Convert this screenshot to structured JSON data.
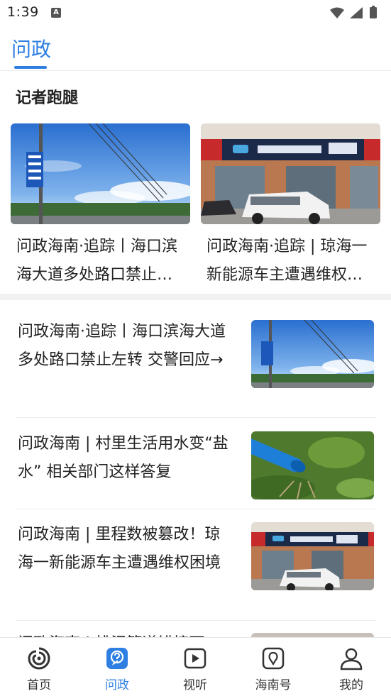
{
  "status_bar": {
    "time": "1:39",
    "notification_icon": "a-icon"
  },
  "top_tab": {
    "label": "问政"
  },
  "section": {
    "title": "记者跑腿"
  },
  "cards": [
    {
      "title": "问政海南·追踪丨海口滨海大道多处路口禁止左转 交警回应→",
      "image": "road-sign-sky-photo"
    },
    {
      "title": "问政海南·追踪 | 琼海一新能源车主遭遇维权困境",
      "image": "car-dealer-storefront-photo"
    }
  ],
  "news": [
    {
      "title": "问政海南·追踪丨海口滨海大道多处路口禁止左转 交警回应→",
      "image": "road-sign-sky-photo"
    },
    {
      "title": "问政海南 | 村里生活用水变“盐水” 相关部门这样答复",
      "image": "blue-water-pipe-photo"
    },
    {
      "title": "问政海南 | 里程数被篡改！琼海一新能源车主遭遇维权困境",
      "image": "car-dealer-storefront-photo"
    },
    {
      "title": "问政海南 | 排污管道错接下",
      "image": "partial-photo"
    }
  ],
  "bottom_nav": [
    {
      "label": "首页",
      "icon": "home-swirl-icon",
      "active": false
    },
    {
      "label": "问政",
      "icon": "question-bubble-icon",
      "active": true
    },
    {
      "label": "视听",
      "icon": "play-icon",
      "active": false
    },
    {
      "label": "海南号",
      "icon": "hainan-account-icon",
      "active": false
    },
    {
      "label": "我的",
      "icon": "person-icon",
      "active": false
    }
  ],
  "colors": {
    "accent": "#2f7fe3",
    "separator": "#f1f1f1",
    "text": "#222222"
  }
}
